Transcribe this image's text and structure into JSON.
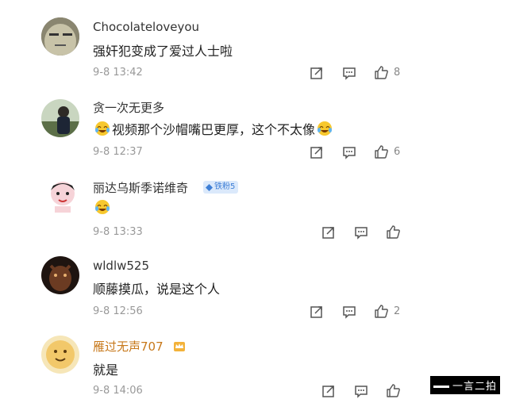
{
  "comments": [
    {
      "username": "Chocolateloveyou",
      "text": "强奸犯变成了爱过人士啦",
      "time": "9-8 13:42",
      "likes": "8"
    },
    {
      "username": "贪一次无更多",
      "text": "视频那个沙帽嘴巴更厚，这个不太像",
      "time": "9-8 12:37",
      "likes": "6"
    },
    {
      "username": "丽达乌斯季诺维奇",
      "badge": "铁粉5",
      "text": "",
      "time": "9-8 13:33",
      "likes": ""
    },
    {
      "username": "wldlw525",
      "text": "顺藤摸瓜，说是这个人",
      "time": "9-8 12:56",
      "likes": "2"
    },
    {
      "username": "雁过无声707",
      "text": "就是",
      "time": "9-8 14:06",
      "likes": ""
    }
  ],
  "watermark": "一言二拍",
  "colors": {
    "username_gold": "#c7781a",
    "badge_bg": "#dbe9fb",
    "badge_text": "#3f7fd6",
    "meta": "#999999"
  },
  "icons": [
    "repost-icon",
    "comment-icon",
    "like-icon",
    "laugh-cry-emoji",
    "vip-crown-icon"
  ]
}
